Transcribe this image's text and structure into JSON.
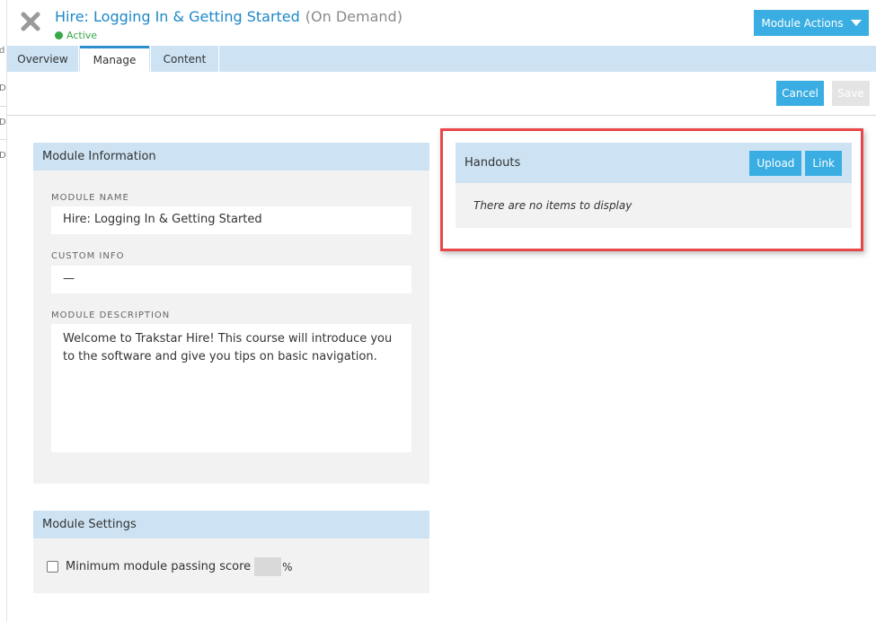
{
  "header": {
    "title": "Hire: Logging In & Getting Started",
    "subtitle": "(On Demand)",
    "status": "Active",
    "actions_label": "Module Actions"
  },
  "tabs": [
    {
      "label": "Overview"
    },
    {
      "label": "Manage"
    },
    {
      "label": "Content"
    }
  ],
  "active_tab": "Manage",
  "toolbar": {
    "cancel_label": "Cancel",
    "save_label": "Save"
  },
  "left_strip": {
    "letters": [
      "d",
      "D",
      "D",
      "D"
    ]
  },
  "module_info": {
    "heading": "Module Information",
    "name_label": "MODULE NAME",
    "name_value": "Hire: Logging In & Getting Started",
    "custom_label": "CUSTOM INFO",
    "custom_value": "—",
    "description_label": "MODULE DESCRIPTION",
    "description_value": "Welcome to Trakstar Hire! This course will introduce you to the software and give you tips on basic navigation."
  },
  "handouts": {
    "heading": "Handouts",
    "upload_label": "Upload",
    "link_label": "Link",
    "empty_message": "There are no items to display"
  },
  "module_settings": {
    "heading": "Module Settings",
    "passing_score_label": "Minimum module passing score",
    "percent_symbol": "%",
    "passing_score_checked": false
  },
  "colors": {
    "accent": "#3aaee2",
    "title": "#1e88c7",
    "panel_header": "#cde3f3",
    "status_active": "#35a847",
    "highlight": "#e8474a"
  }
}
